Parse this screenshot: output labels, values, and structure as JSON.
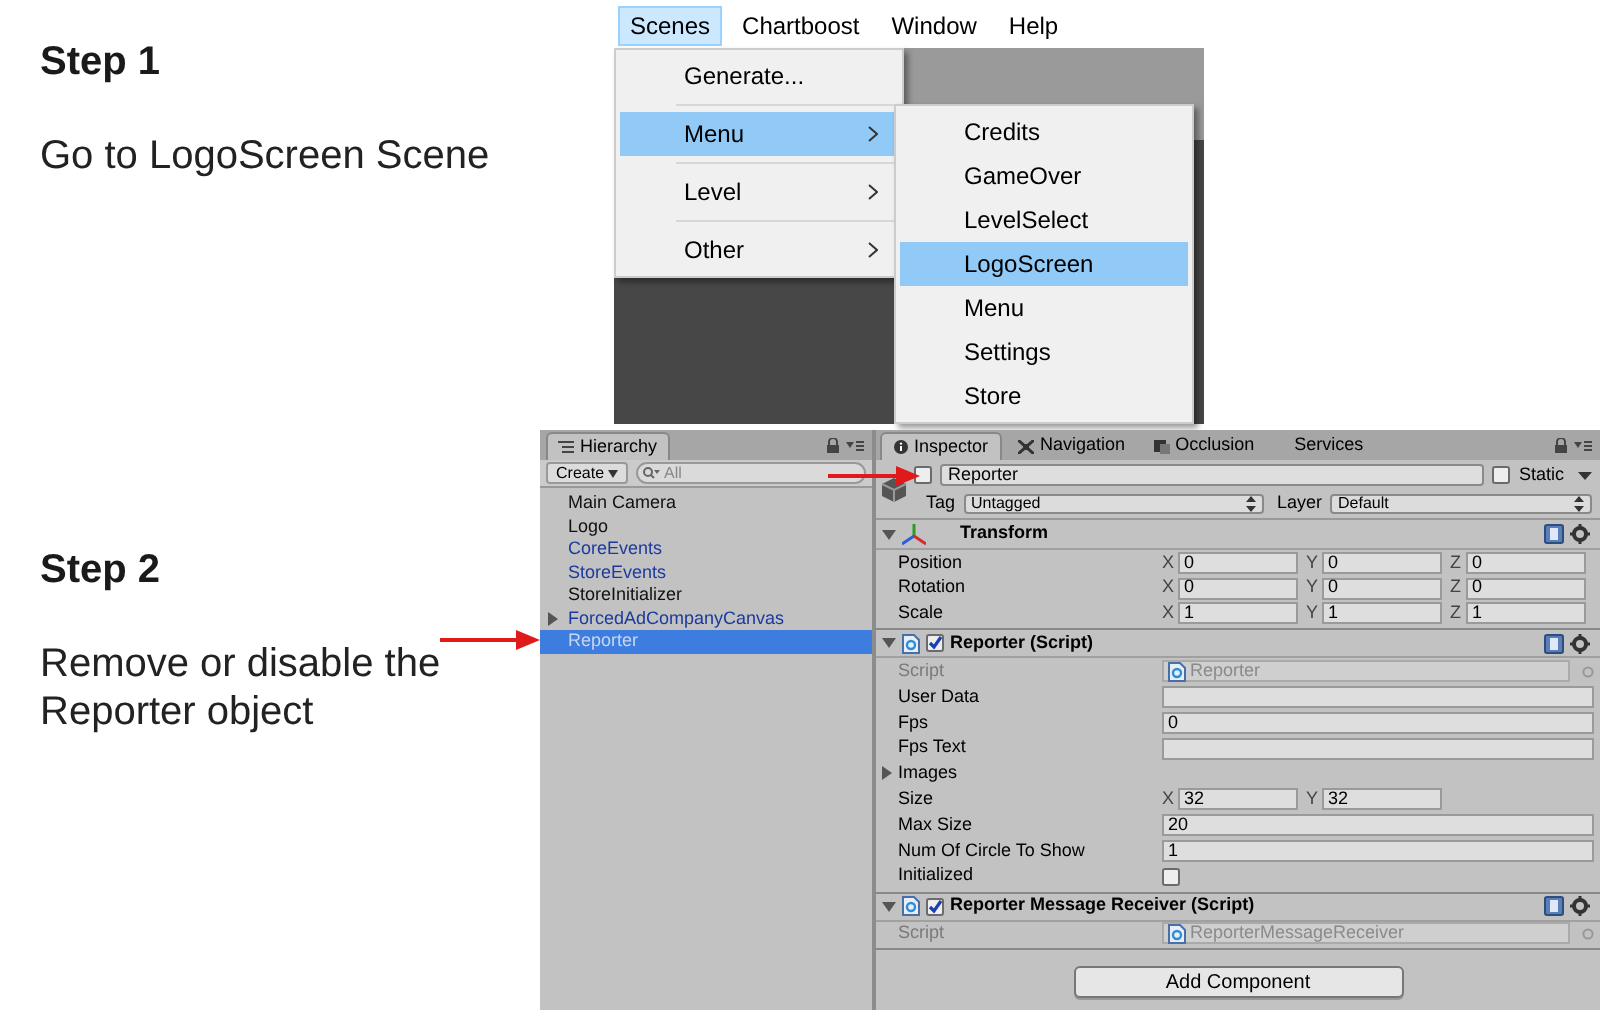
{
  "steps": [
    {
      "title": "Step 1",
      "text": "Go to LogoScreen Scene"
    },
    {
      "title": "Step 2",
      "text": "Remove or disable the Reporter object"
    }
  ],
  "menu_bar": [
    {
      "label": "Scenes",
      "selected": true
    },
    {
      "label": "Chartboost",
      "selected": false
    },
    {
      "label": "Window",
      "selected": false
    },
    {
      "label": "Help",
      "selected": false
    }
  ],
  "scenes_menu": [
    {
      "label": "Generate...",
      "selected": false,
      "submenu": false
    },
    {
      "label": "Menu",
      "selected": true,
      "submenu": true
    },
    {
      "label": "Level",
      "selected": false,
      "submenu": true
    },
    {
      "label": "Other",
      "selected": false,
      "submenu": true
    }
  ],
  "menu_submenu": [
    {
      "label": "Credits",
      "selected": false
    },
    {
      "label": "GameOver",
      "selected": false
    },
    {
      "label": "LevelSelect",
      "selected": false
    },
    {
      "label": "LogoScreen",
      "selected": true
    },
    {
      "label": "Menu",
      "selected": false
    },
    {
      "label": "Settings",
      "selected": false
    },
    {
      "label": "Store",
      "selected": false
    }
  ],
  "hierarchy": {
    "title": "Hierarchy",
    "create": "Create",
    "search_placeholder": "All",
    "items": [
      {
        "label": "Main Camera",
        "prefab": false,
        "selected": false
      },
      {
        "label": "Logo",
        "prefab": false,
        "selected": false
      },
      {
        "label": "CoreEvents",
        "prefab": true,
        "selected": false
      },
      {
        "label": "StoreEvents",
        "prefab": true,
        "selected": false
      },
      {
        "label": "StoreInitializer",
        "prefab": false,
        "selected": false
      },
      {
        "label": "ForcedAdCompanyCanvas",
        "prefab": true,
        "selected": false,
        "expanded": false
      },
      {
        "label": "Reporter",
        "prefab": true,
        "selected": true
      }
    ]
  },
  "inspector": {
    "tabs": [
      {
        "label": "Inspector",
        "selected": true
      },
      {
        "label": "Navigation",
        "selected": false
      },
      {
        "label": "Occlusion",
        "selected": false
      },
      {
        "label": "Services",
        "selected": false
      }
    ],
    "object": {
      "active": false,
      "name": "Reporter",
      "static_label": "Static",
      "static": false,
      "tag_label": "Tag",
      "tag": "Untagged",
      "layer_label": "Layer",
      "layer": "Default"
    },
    "components": [
      {
        "kind": "transform",
        "title": "Transform",
        "rows": [
          {
            "kind": "vector",
            "label": "Position",
            "fields": [
              {
                "axis": "X",
                "value": "0"
              },
              {
                "axis": "Y",
                "value": "0"
              },
              {
                "axis": "Z",
                "value": "0"
              }
            ]
          },
          {
            "kind": "vector",
            "label": "Rotation",
            "fields": [
              {
                "axis": "X",
                "value": "0"
              },
              {
                "axis": "Y",
                "value": "0"
              },
              {
                "axis": "Z",
                "value": "0"
              }
            ]
          },
          {
            "kind": "vector",
            "label": "Scale",
            "fields": [
              {
                "axis": "X",
                "value": "1"
              },
              {
                "axis": "Y",
                "value": "1"
              },
              {
                "axis": "Z",
                "value": "1"
              }
            ]
          }
        ]
      },
      {
        "kind": "script",
        "title": "Reporter (Script)",
        "enabled": true,
        "rows": [
          {
            "kind": "object",
            "label": "Script",
            "value": "Reporter"
          },
          {
            "kind": "text",
            "label": "User Data"
          },
          {
            "kind": "text",
            "label": "Fps",
            "value": "0"
          },
          {
            "kind": "text",
            "label": "Fps Text"
          },
          {
            "kind": "foldout",
            "label": "Images",
            "expanded": false
          },
          {
            "kind": "vector",
            "label": "Size",
            "fields": [
              {
                "axis": "X",
                "value": "32"
              },
              {
                "axis": "Y",
                "value": "32"
              }
            ]
          },
          {
            "kind": "text",
            "label": "Max Size",
            "value": "20"
          },
          {
            "kind": "text",
            "label": "Num Of Circle To Show",
            "value": "1"
          },
          {
            "kind": "toggle",
            "label": "Initialized",
            "checked": false
          }
        ]
      },
      {
        "kind": "script",
        "title": "Reporter Message Receiver (Script)",
        "enabled": true,
        "rows": [
          {
            "kind": "object",
            "label": "Script",
            "value": "ReporterMessageReceiver"
          }
        ]
      }
    ],
    "add_component": "Add Component"
  }
}
